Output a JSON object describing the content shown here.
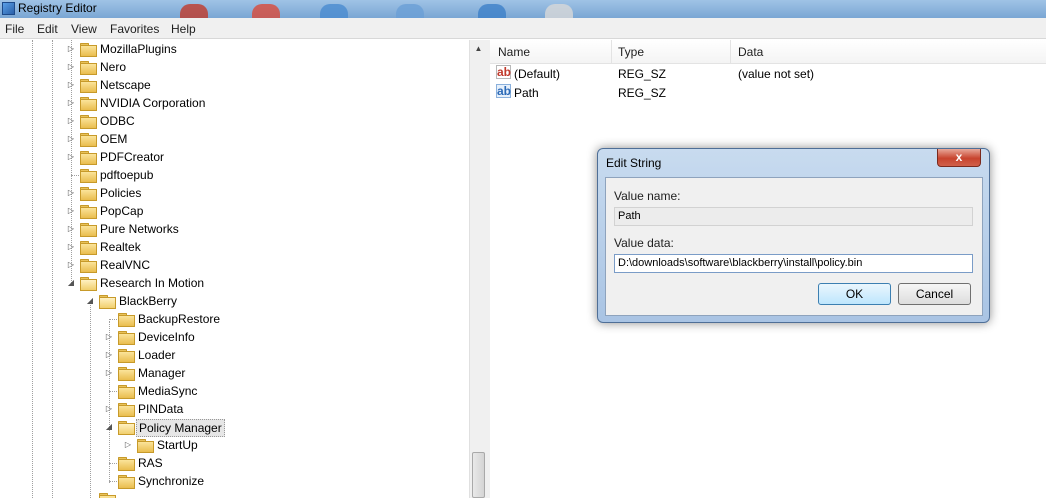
{
  "window": {
    "title": "Registry Editor"
  },
  "menu": [
    "File",
    "Edit",
    "View",
    "Favorites",
    "Help"
  ],
  "tree": {
    "items": [
      {
        "label": "MozillaPlugins"
      },
      {
        "label": "Nero"
      },
      {
        "label": "Netscape"
      },
      {
        "label": "NVIDIA Corporation"
      },
      {
        "label": "ODBC"
      },
      {
        "label": "OEM"
      },
      {
        "label": "PDFCreator"
      },
      {
        "label": "pdftoepub"
      },
      {
        "label": "Policies"
      },
      {
        "label": "PopCap"
      },
      {
        "label": "Pure Networks"
      },
      {
        "label": "Realtek"
      },
      {
        "label": "RealVNC"
      },
      {
        "label": "Research In Motion"
      },
      {
        "label": "BlackBerry"
      },
      {
        "label": "BackupRestore"
      },
      {
        "label": "DeviceInfo"
      },
      {
        "label": "Loader"
      },
      {
        "label": "Manager"
      },
      {
        "label": "MediaSync"
      },
      {
        "label": "PINData"
      },
      {
        "label": "Policy Manager"
      },
      {
        "label": "StartUp"
      },
      {
        "label": "RAS"
      },
      {
        "label": "Synchronize"
      }
    ]
  },
  "list": {
    "headers": {
      "name": "Name",
      "type": "Type",
      "data": "Data"
    },
    "rows": [
      {
        "name": "(Default)",
        "type": "REG_SZ",
        "data": "(value not set)",
        "icon": "string-value-icon"
      },
      {
        "name": "Path",
        "type": "REG_SZ",
        "data": "",
        "icon": "string-value-selected-icon"
      }
    ]
  },
  "dialog": {
    "title": "Edit String",
    "close": "x",
    "value_name_label": "Value name:",
    "value_name": "Path",
    "value_data_label": "Value data:",
    "value_data": "D:\\downloads\\software\\blackberry\\install\\policy.bin",
    "ok": "OK",
    "cancel": "Cancel"
  },
  "icons": {
    "regicon": "ab"
  },
  "colors": {
    "selection": "#e6e6e6",
    "dialog_frame": "#a9c4e4",
    "close_button": "#c8442e"
  }
}
